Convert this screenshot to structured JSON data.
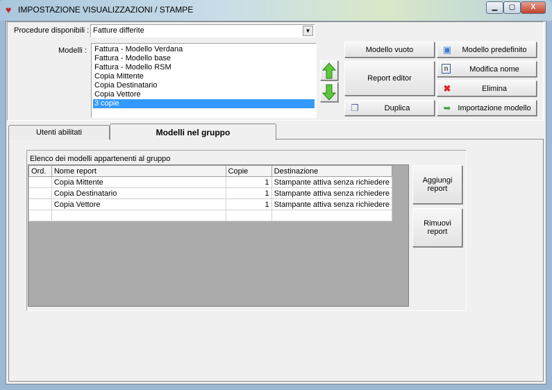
{
  "window": {
    "title": "IMPOSTAZIONE VISUALIZZAZIONI / STAMPE",
    "minimize": "▁",
    "maximize": "▢",
    "close": "X"
  },
  "procedure": {
    "label": "Procedure disponibili :",
    "value": "Fatture differite"
  },
  "modelli": {
    "label": "Modelli :",
    "items": [
      "Fattura - Modello Verdana",
      "Fattura - Modello base",
      "Fattura - Modello RSM",
      "Copia Mittente",
      "Copia Destinatario",
      "Copia Vettore",
      "3 copie"
    ],
    "selected": "3 copie"
  },
  "buttons": {
    "modello_vuoto": "Modello vuoto",
    "modello_predefinito": "Modello predefinito",
    "report_editor": "Report editor",
    "modifica_nome": "Modifica nome",
    "elimina": "Elimina",
    "duplica": "Duplica",
    "importazione": "Importazione modello",
    "aggiungi": "Aggiungi report",
    "rimuovi": "Rimuovi report"
  },
  "tabs": [
    {
      "label": "Utenti abilitati"
    },
    {
      "label": "Modelli nel gruppo",
      "active": true
    }
  ],
  "group": {
    "title": "Elenco dei modelli appartenenti al gruppo",
    "columns": [
      "Ord.",
      "Nome report",
      "Copie",
      "Destinazione"
    ],
    "rows": [
      [
        "",
        "Copia Mittente",
        "1",
        "Stampante attiva senza richiedere"
      ],
      [
        "",
        "Copia Destinatario",
        "1",
        "Stampante attiva senza richiedere"
      ],
      [
        "",
        "Copia Vettore",
        "1",
        "Stampante attiva senza richiedere"
      ],
      [
        "",
        "",
        "",
        ""
      ]
    ]
  },
  "colors": {
    "selection": "#3399ff",
    "grid_background": "#ababab",
    "arrow": "#4caf32"
  }
}
